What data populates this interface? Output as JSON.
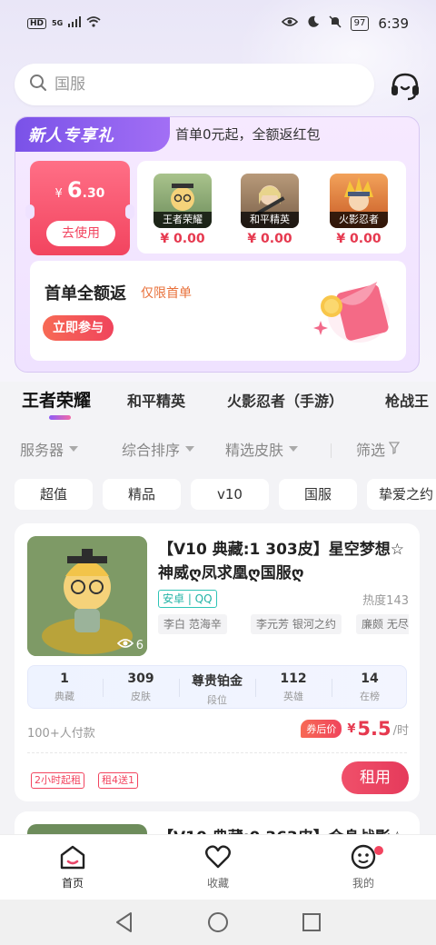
{
  "status_bar": {
    "net_label": "HD",
    "net_type": "5G",
    "battery": "97",
    "time": "6:39"
  },
  "search": {
    "placeholder": "国服"
  },
  "promo": {
    "tag": "新人专享礼",
    "subtitle": "首单0元起，全额返红包",
    "coupon": {
      "currency": "¥",
      "amount_int": "6",
      "amount_dec": ".30",
      "button": "去使用"
    },
    "games": [
      {
        "name": "王者荣耀",
        "price": "¥ 0.00",
        "color": "#7a9a63"
      },
      {
        "name": "和平精英",
        "price": "¥ 0.00",
        "color": "#8a6d52"
      },
      {
        "name": "火影忍者",
        "price": "¥ 0.00",
        "color": "#d3702e"
      }
    ],
    "fullback": {
      "title": "首单全额返",
      "note": "仅限首单",
      "button": "立即参与"
    }
  },
  "tabs": [
    {
      "label": "王者荣耀",
      "active": true
    },
    {
      "label": "和平精英",
      "active": false
    },
    {
      "label": "火影忍者（手游）",
      "active": false
    },
    {
      "label": "枪战王",
      "active": false
    }
  ],
  "filters": {
    "server": "服务器",
    "sort": "综合排序",
    "skins": "精选皮肤",
    "screen": "筛选"
  },
  "chips": [
    "超值",
    "精品",
    "v10",
    "国服",
    "挚爱之约"
  ],
  "listing": {
    "title": "【V10 典藏:1 303皮】星空梦想☆神威ღ凤求凰ღ国服ღ",
    "views": "6",
    "platform": "安卓 | QQ",
    "heat": "热度143",
    "skins": [
      "李白 范海辛",
      "李元芳 银河之约",
      "廉颇 无尽征"
    ],
    "stats": [
      {
        "value": "1",
        "label": "典藏"
      },
      {
        "value": "309",
        "label": "皮肤"
      },
      {
        "value": "尊贵铂金",
        "label": "段位"
      },
      {
        "value": "112",
        "label": "英雄"
      },
      {
        "value": "14",
        "label": "在榜"
      }
    ],
    "paid": "100+人付款",
    "coupon_after": "券后价",
    "currency": "¥",
    "price": "5.5",
    "unit": "/时",
    "rent_tags": [
      "2小时起租",
      "租4送1"
    ],
    "rent_button": "租用"
  },
  "listing2": {
    "title": "【V10 典藏:0 363皮】金身战影☆"
  },
  "bottom_nav": [
    {
      "label": "首页",
      "active": true
    },
    {
      "label": "收藏",
      "active": false
    },
    {
      "label": "我的",
      "active": false
    }
  ]
}
